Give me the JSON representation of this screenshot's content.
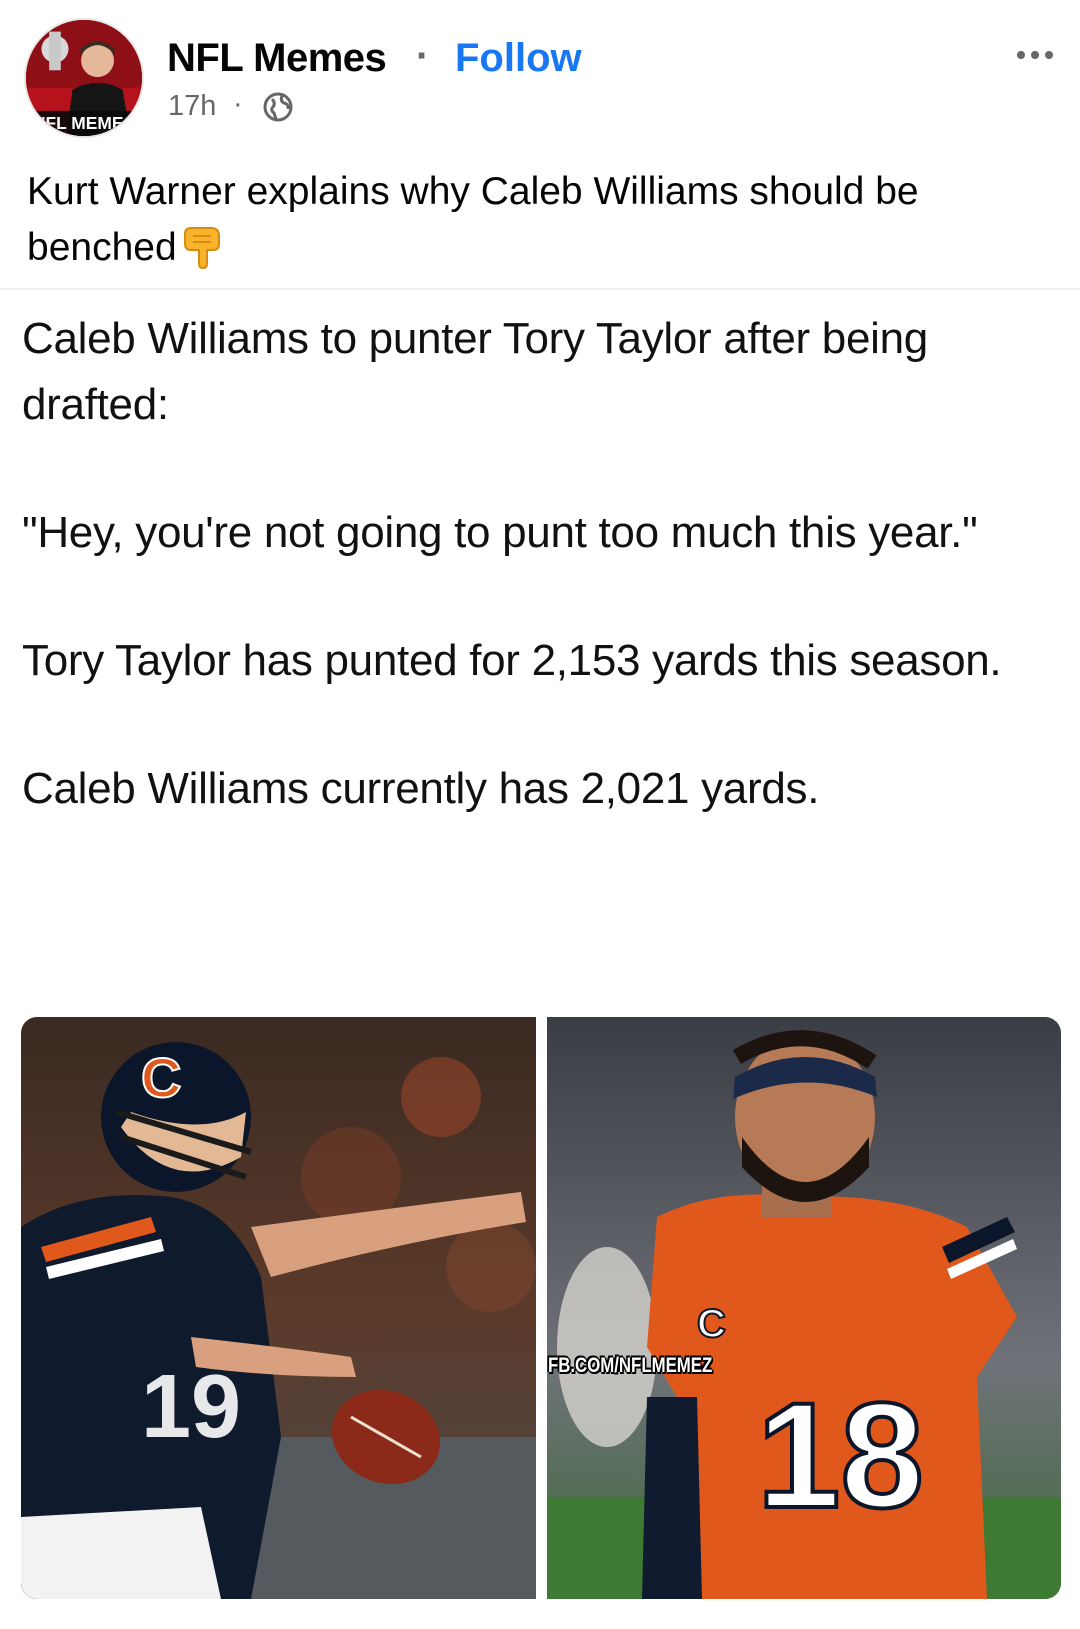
{
  "post": {
    "page_name": "NFL Memes",
    "separator": "·",
    "follow_label": "Follow",
    "time": "17h",
    "time_separator": "·",
    "audience_icon": "globe-icon",
    "more_icon": "more-options-icon",
    "avatar_text": "NFL MEMES",
    "caption": "Kurt Warner explains why Caleb Williams should be benched",
    "caption_emoji": "pointing-down-hand-emoji"
  },
  "tweet": {
    "paragraphs": [
      "Caleb Williams to punter Tory Taylor after being drafted:",
      "\"Hey, you're not going to punt too much this year.\"",
      "Tory Taylor has punted for 2,153 yards this season.",
      "Caleb Williams currently has 2,021 yards."
    ]
  },
  "images": {
    "left_description_icon": "punter-photo",
    "right_description_icon": "quarterback-photo",
    "left_jersey_number": "19",
    "right_jersey_number": "18",
    "watermark": "FB.COM/NFLMEMEZ"
  },
  "colors": {
    "follow_blue": "#1877f2",
    "secondary_text": "#65676b",
    "bears_navy": "#0b162a",
    "bears_orange": "#e0581c"
  }
}
